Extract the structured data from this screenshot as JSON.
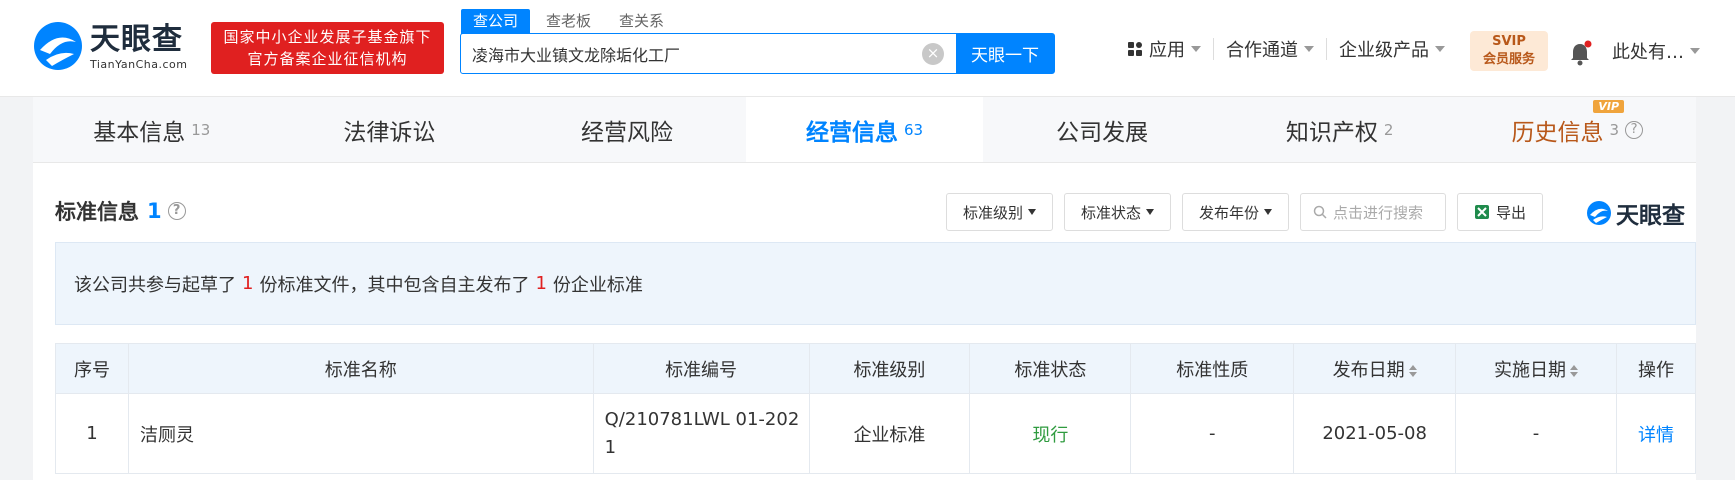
{
  "header": {
    "logo_cn": "天眼查",
    "logo_en": "TianYanCha.com",
    "badge_line1": "国家中小企业发展子基金旗下",
    "badge_line2": "官方备案企业征信机构",
    "search_tabs": [
      "查公司",
      "查老板",
      "查关系"
    ],
    "search_value": "凌海市大业镇文龙除垢化工厂",
    "search_button": "天眼一下",
    "nav": [
      "应用",
      "合作通道",
      "企业级产品"
    ],
    "svip_line1": "SVIP",
    "svip_line2": "会员服务",
    "user": "此处有…"
  },
  "tabs": [
    {
      "label": "基本信息",
      "count": "13"
    },
    {
      "label": "法律诉讼",
      "count": ""
    },
    {
      "label": "经营风险",
      "count": ""
    },
    {
      "label": "经营信息",
      "count": "63"
    },
    {
      "label": "公司发展",
      "count": ""
    },
    {
      "label": "知识产权",
      "count": "2"
    },
    {
      "label": "历史信息",
      "count": "3"
    }
  ],
  "vip_badge": "VIP",
  "section": {
    "title": "标准信息",
    "count": "1",
    "filters": [
      "标准级别",
      "标准状态",
      "发布年份"
    ],
    "search_placeholder": "点击进行搜索",
    "export": "导出",
    "brand": "天眼查"
  },
  "summary": {
    "part1": "该公司共参与起草了",
    "n1": "1",
    "part2": "份标准文件，其中包含自主发布了",
    "n2": "1",
    "part3": "份企业标准"
  },
  "table": {
    "headers": [
      "序号",
      "标准名称",
      "标准编号",
      "标准级别",
      "标准状态",
      "标准性质",
      "发布日期",
      "实施日期",
      "操作"
    ],
    "rows": [
      {
        "idx": "1",
        "name": "洁厕灵",
        "code": "Q/210781LWL 01-2021",
        "level": "企业标准",
        "status": "现行",
        "nature": "-",
        "pub": "2021-05-08",
        "impl": "-",
        "action": "详情"
      }
    ]
  },
  "colors": {
    "primary": "#0084ff",
    "red": "#e02020",
    "green": "#2f9b3f",
    "orange": "#b8581a"
  }
}
